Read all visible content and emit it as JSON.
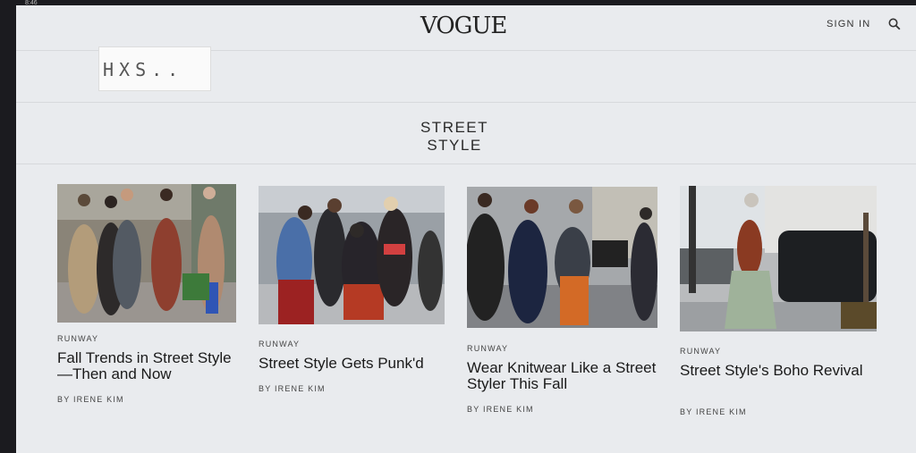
{
  "status": {
    "time": "8:46"
  },
  "header": {
    "logo": "VOGUE",
    "sign_in": "SIGN IN",
    "search_icon": "search-icon"
  },
  "overlay": {
    "text": "HXS.."
  },
  "section": {
    "title_line1": "STREET",
    "title_line2": "STYLE"
  },
  "articles": [
    {
      "kicker": "RUNWAY",
      "headline": "Fall Trends in Street Style—Then and Now",
      "byline": "BY IRENE KIM"
    },
    {
      "kicker": "RUNWAY",
      "headline": "Street Style Gets Punk'd",
      "byline": "BY IRENE KIM"
    },
    {
      "kicker": "RUNWAY",
      "headline": "Wear Knitwear Like a Street Styler This Fall",
      "byline": "BY IRENE KIM"
    },
    {
      "kicker": "RUNWAY",
      "headline": "Street Style's Boho Revival",
      "byline": "BY IRENE KIM"
    }
  ]
}
